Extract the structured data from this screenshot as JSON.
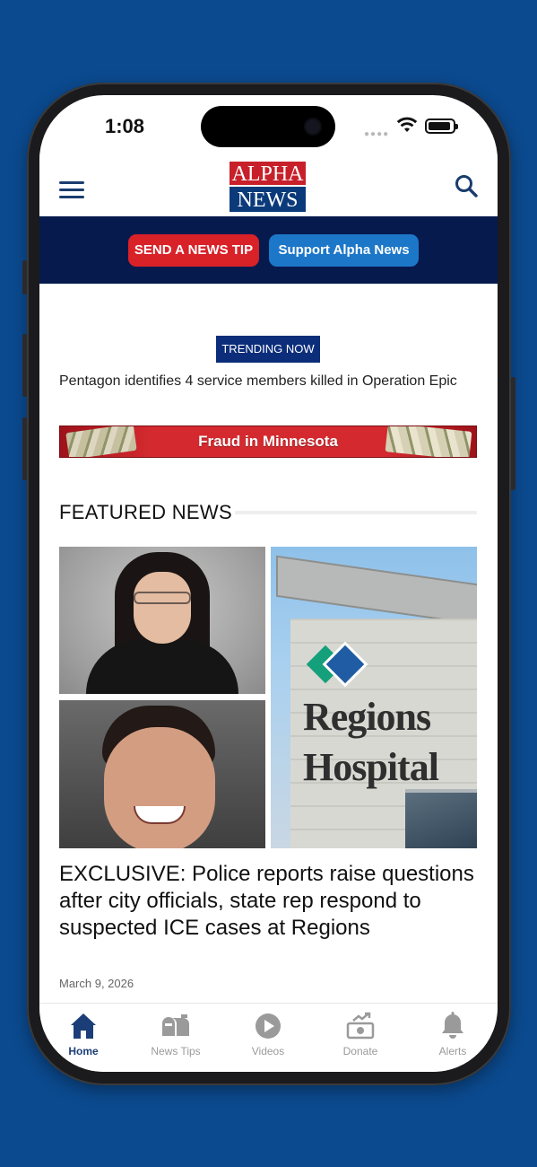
{
  "status_bar": {
    "time": "1:08"
  },
  "header": {
    "logo_top": "ALPHA",
    "logo_bottom": "NEWS"
  },
  "cta": {
    "news_tip": "SEND A NEWS TIP",
    "support": "Support Alpha News"
  },
  "trending": {
    "label": "TRENDING NOW",
    "headline": "Pentagon identifies 4 service members killed in Operation Epic"
  },
  "banner": {
    "text": "Fraud in Minnesota"
  },
  "featured": {
    "section_title": "FEATURED NEWS",
    "article": {
      "title": "EXCLUSIVE: Police reports raise questions after city officials, state rep respond to suspected ICE cases at Regions",
      "date": "March 9, 2026",
      "photo_sign": [
        "Regions",
        "Hospital"
      ]
    }
  },
  "tabs": [
    {
      "label": "Home",
      "icon": "home-icon",
      "active": true
    },
    {
      "label": "News Tips",
      "icon": "mailbox-icon",
      "active": false
    },
    {
      "label": "Videos",
      "icon": "play-icon",
      "active": false
    },
    {
      "label": "Donate",
      "icon": "donate-icon",
      "active": false
    },
    {
      "label": "Alerts",
      "icon": "bell-icon",
      "active": false
    }
  ],
  "colors": {
    "background": "#0b4a8f",
    "brand_navy": "#061a4d",
    "brand_red": "#d92128",
    "support_blue": "#1d77c9",
    "active_tab": "#1c3e78"
  }
}
